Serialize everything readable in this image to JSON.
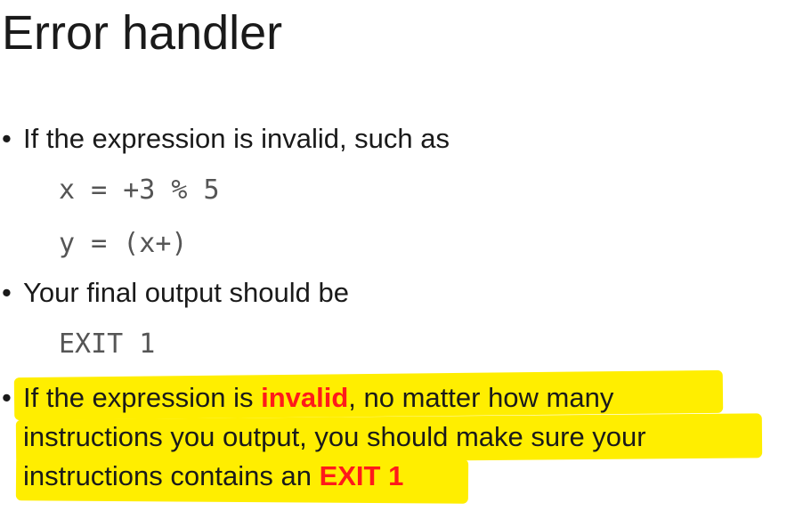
{
  "slide": {
    "title": "Error handler",
    "bullet_char": "•",
    "bullet1": "If the expression is invalid, such as",
    "code1_line1": "x = +3 % 5",
    "code1_line2": "y = (x+)",
    "bullet2": "Your final output should be",
    "code2": "EXIT 1",
    "bullet3": {
      "line1_before": "If the expression is ",
      "line1_emph": "invalid",
      "line1_after": ", no matter how many",
      "line2": "instructions you output, you should make sure your",
      "line3_before": "instructions contains an ",
      "line3_emph": "EXIT 1"
    }
  },
  "colors": {
    "highlight": "#ffee00",
    "emphasis": "#ff1a1a",
    "code_text": "#555555"
  }
}
